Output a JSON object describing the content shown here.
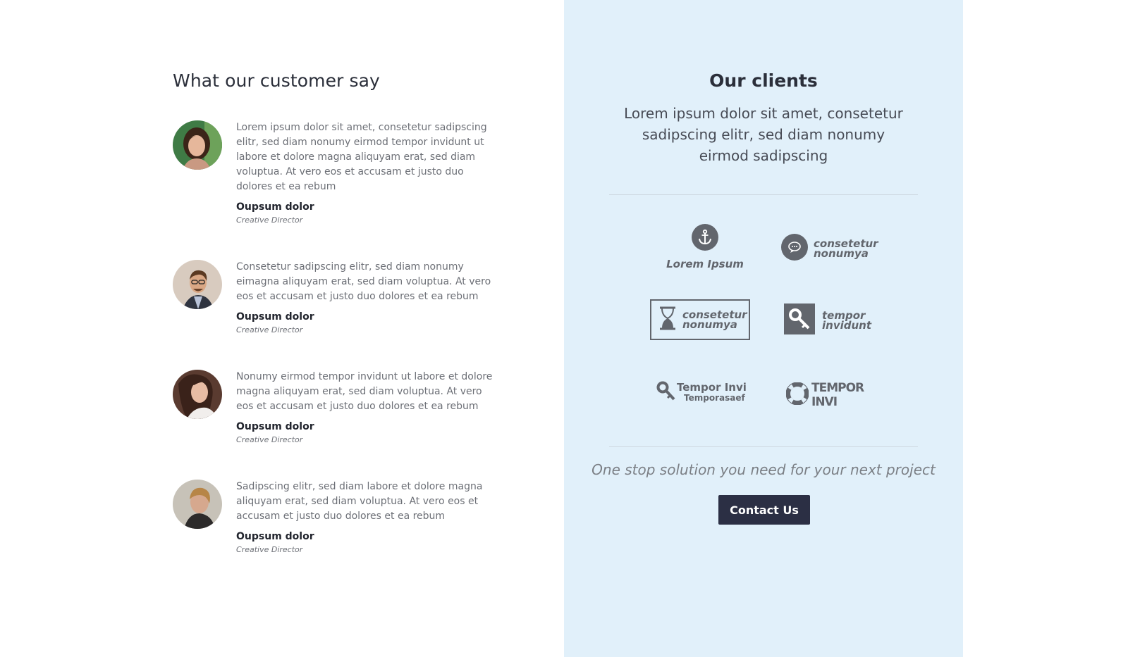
{
  "testimonials_section": {
    "title": "What our customer say",
    "items": [
      {
        "text": "Lorem ipsum dolor sit amet, consetetur sadipscing elitr, sed diam nonumy eirmod tempor invidunt ut labore et dolore magna aliquyam erat, sed diam voluptua. At vero eos et accusam et justo duo dolores et ea rebum",
        "name": "Oupsum dolor",
        "role": "Creative Director"
      },
      {
        "text": "Consetetur sadipscing elitr, sed diam nonumy eimagna aliquyam erat, sed diam voluptua. At vero eos et accusam et justo duo dolores et ea rebum",
        "name": "Oupsum dolor",
        "role": "Creative Director"
      },
      {
        "text": "Nonumy eirmod tempor invidunt ut labore et dolore magna aliquyam erat, sed diam voluptua. At vero eos et accusam et justo duo dolores et ea rebum",
        "name": "Oupsum dolor",
        "role": "Creative Director"
      },
      {
        "text": "Sadipscing elitr, sed diam labore et dolore magna aliquyam erat, sed diam voluptua. At vero eos et accusam et justo duo dolores et ea rebum",
        "name": "Oupsum dolor",
        "role": "Creative Director"
      }
    ]
  },
  "clients_section": {
    "title": "Our clients",
    "subtitle": "Lorem ipsum dolor sit amet, consetetur sadipscing elitr, sed diam nonumy eirmod sadipscing",
    "logos": [
      {
        "icon": "anchor-icon",
        "line1": "Lorem Ipsum"
      },
      {
        "icon": "speech-bubble-icon",
        "line1": "consetetur",
        "line2": "nonumya"
      },
      {
        "icon": "hourglass-icon",
        "line1": "consetetur",
        "line2": "nonumya"
      },
      {
        "icon": "key-icon",
        "line1": "tempor",
        "line2": "invidunt"
      },
      {
        "icon": "key-icon",
        "line1": "Tempor Invi",
        "line2": "Temporasaef"
      },
      {
        "icon": "lifebuoy-icon",
        "line1": "TEMPOR INVI"
      }
    ],
    "tagline": "One stop solution you need for your next project",
    "contact_label": "Contact Us"
  },
  "colors": {
    "panel_bg": "#e1f0fa",
    "button_bg": "#2b2f44",
    "logo_gray": "#62666d"
  }
}
